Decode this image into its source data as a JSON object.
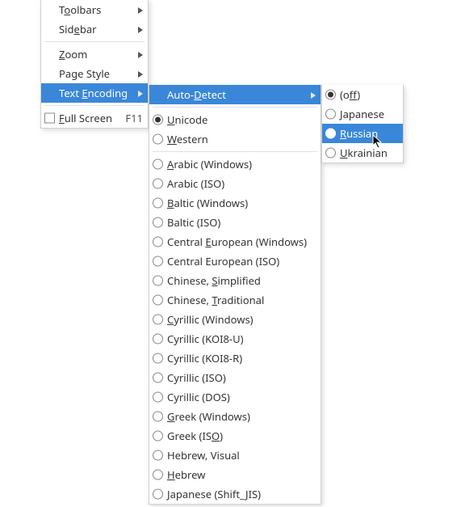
{
  "main_menu": {
    "toolbars": {
      "pre": "T",
      "mn": "o",
      "post": "olbars"
    },
    "sidebar": {
      "pre": "Sid",
      "mn": "e",
      "post": "bar"
    },
    "zoom": {
      "pre": "",
      "mn": "Z",
      "post": "oom"
    },
    "page_style": {
      "label": "Page Style"
    },
    "text_encoding": {
      "pre": "Text ",
      "mn": "E",
      "post": "ncoding"
    },
    "full_screen": {
      "pre": "",
      "mn": "F",
      "post": "ull Screen",
      "accel": "F11"
    }
  },
  "encoding_menu": {
    "auto_detect": {
      "pre": "Auto-",
      "mn": "D",
      "post": "etect"
    },
    "unicode": {
      "pre": "",
      "mn": "U",
      "post": "nicode",
      "selected": true
    },
    "western": {
      "pre": "",
      "mn": "W",
      "post": "estern"
    },
    "arabic_win": {
      "pre": "",
      "mn": "A",
      "post": "rabic (Windows)"
    },
    "arabic_iso": {
      "label": "Arabic (ISO)"
    },
    "baltic_win": {
      "pre": "",
      "mn": "B",
      "post": "altic (Windows)"
    },
    "baltic_iso": {
      "label": "Baltic (ISO)"
    },
    "ce_win": {
      "pre": "Central ",
      "mn": "E",
      "post": "uropean (Windows)"
    },
    "ce_iso": {
      "label": "Central European (ISO)"
    },
    "chinese_s": {
      "pre": "Chinese, ",
      "mn": "S",
      "post": "implified"
    },
    "chinese_t": {
      "pre": "Chinese, ",
      "mn": "T",
      "post": "raditional"
    },
    "cyr_win": {
      "pre": "",
      "mn": "C",
      "post": "yrillic (Windows)"
    },
    "cyr_koi8u": {
      "label": "Cyrillic (KOI8-U)"
    },
    "cyr_koi8r": {
      "label": "Cyrillic (KOI8-R)"
    },
    "cyr_iso": {
      "label": "Cyrillic (ISO)"
    },
    "cyr_dos": {
      "label": "Cyrillic (DOS)"
    },
    "greek_win": {
      "pre": "",
      "mn": "G",
      "post": "reek (Windows)"
    },
    "greek_iso": {
      "pre": "Greek (IS",
      "mn": "O",
      "post": ")"
    },
    "heb_vis": {
      "label": "Hebrew, Visual"
    },
    "heb": {
      "pre": "",
      "mn": "H",
      "post": "ebrew"
    },
    "jap_sjis": {
      "pre": "",
      "mn": "J",
      "post": "apanese (Shift_",
      "mn2": "J",
      "post2": "IS)"
    }
  },
  "autodetect_menu": {
    "off": {
      "pre": "(o",
      "mn": "f",
      "post": "f)",
      "selected": true
    },
    "japanese": {
      "pre": "",
      "mn": "J",
      "post": "apanese"
    },
    "russian": {
      "pre": "",
      "mn": "R",
      "post": "ussian"
    },
    "ukrainian": {
      "pre": "",
      "mn": "U",
      "post": "krainian"
    }
  }
}
